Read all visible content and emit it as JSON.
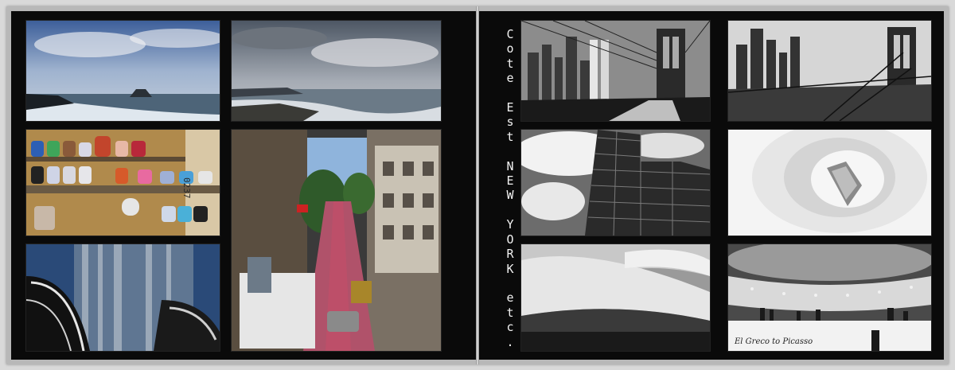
{
  "spread": {
    "right_page_title_chars": [
      "C",
      "o",
      "t",
      "e",
      " ",
      "E",
      "s",
      "t",
      " ",
      "N",
      "E",
      "W",
      " ",
      "Y",
      "O",
      "R",
      "K",
      " ",
      "e",
      "t",
      "c",
      "."
    ],
    "museum_sign": "El Greco to Picasso"
  },
  "photos": {
    "left": [
      {
        "name": "photo-coast-rock"
      },
      {
        "name": "photo-coast-sky"
      },
      {
        "name": "photo-mailboxes"
      },
      {
        "name": "photo-street-hill"
      },
      {
        "name": "photo-sculpture"
      }
    ],
    "right": [
      {
        "name": "photo-bridge-1"
      },
      {
        "name": "photo-bridge-2"
      },
      {
        "name": "photo-glass-building"
      },
      {
        "name": "photo-guggenheim-interior"
      },
      {
        "name": "photo-guggenheim-exterior"
      },
      {
        "name": "photo-guggenheim-ramp"
      }
    ]
  }
}
